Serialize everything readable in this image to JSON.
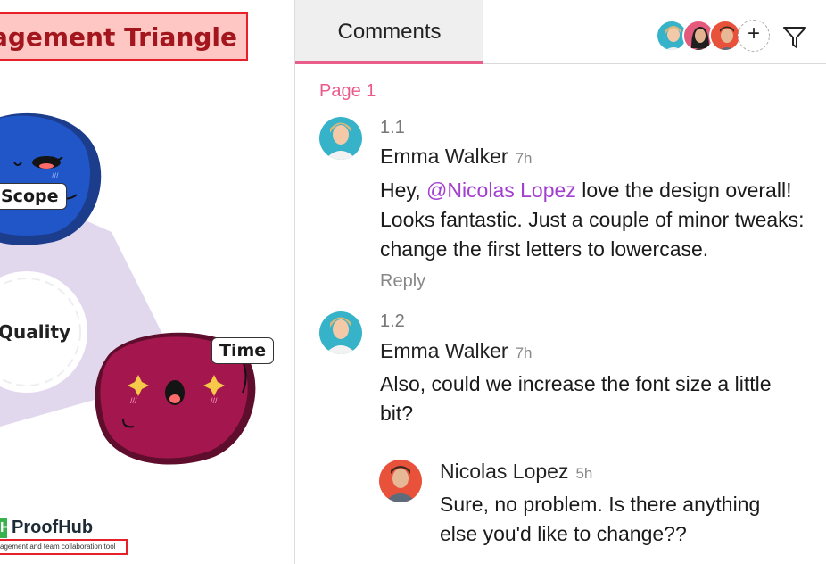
{
  "canvas": {
    "title": "agement Triangle",
    "labels": {
      "scope": "Scope",
      "quality": "Quality",
      "time": "Time"
    },
    "logo": {
      "mark": "H",
      "name": "ProofHub",
      "tagline": "agement and team collaboration tool"
    }
  },
  "panel": {
    "tab_label": "Comments",
    "page_label": "Page 1",
    "add_collaborator": "+",
    "icons": {
      "filter": "filter-icon",
      "add": "plus-icon"
    },
    "colors": {
      "accent": "#e85d8a",
      "mention": "#a23fcf"
    },
    "comments": [
      {
        "number": "1.1",
        "author": "Emma Walker",
        "time": "7h",
        "text_before": "Hey, ",
        "mention": "@Nicolas Lopez",
        "text_after": " love the design overall!  Looks fantastic. Just a couple of minor tweaks: change the first letters to lowercase.",
        "reply_label": "Reply"
      },
      {
        "number": "1.2",
        "author": "Emma Walker",
        "time": "7h",
        "text": "Also, could we increase the font size a little bit?",
        "reply": {
          "author": "Nicolas Lopez",
          "time": "5h",
          "text": "Sure, no problem. Is there anything else you'd like to change??"
        }
      }
    ]
  }
}
